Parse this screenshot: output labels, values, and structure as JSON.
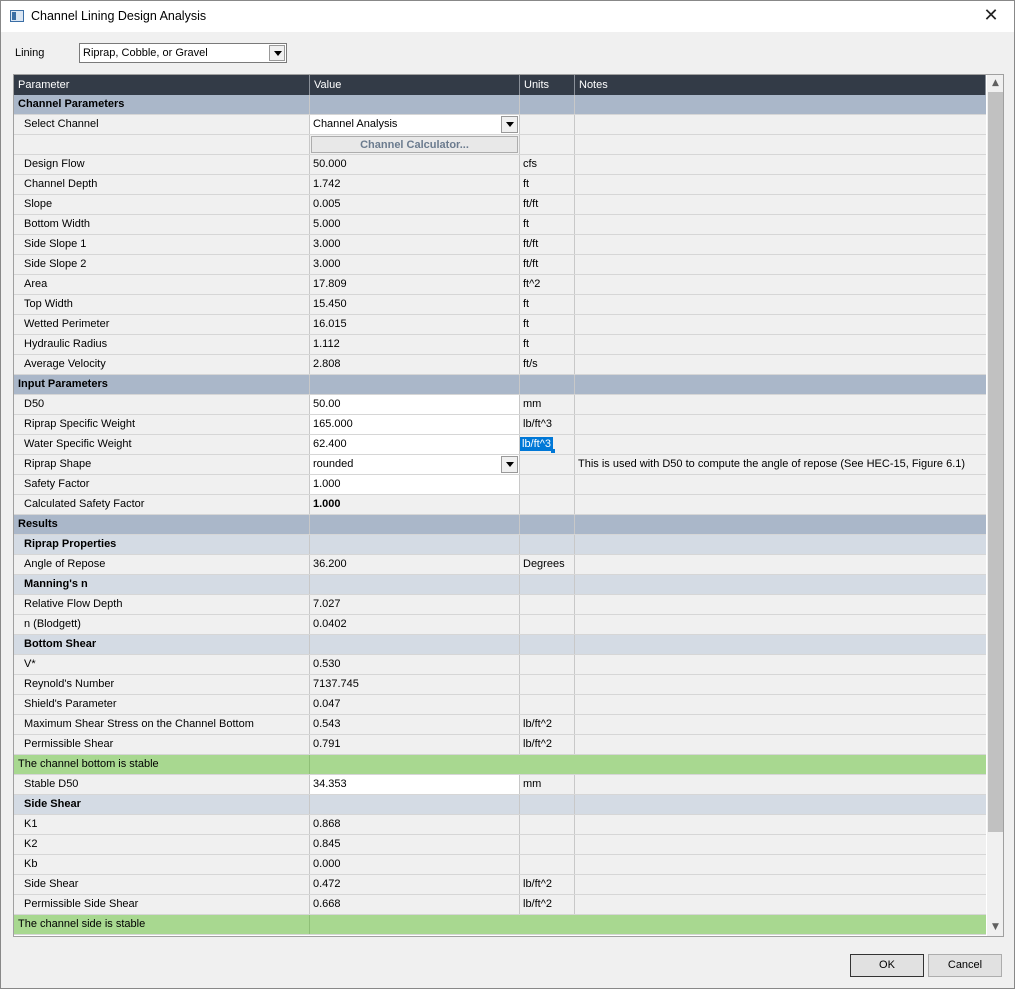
{
  "window": {
    "title": "Channel Lining Design Analysis",
    "close_glyph": "✕"
  },
  "lining": {
    "label": "Lining",
    "value": "Riprap, Cobble, or Gravel"
  },
  "grid": {
    "headers": [
      "Parameter",
      "Value",
      "Units",
      "Notes"
    ],
    "sections": {
      "channel_parameters": "Channel Parameters",
      "input_parameters": "Input Parameters",
      "results": "Results",
      "riprap_properties": "Riprap Properties",
      "mannings_n": "Manning's n",
      "bottom_shear": "Bottom Shear",
      "side_shear": "Side Shear"
    },
    "select_channel": {
      "label": "Select Channel",
      "value": "Channel Analysis"
    },
    "calculator_button": "Channel Calculator...",
    "channel_rows": [
      {
        "label": "Design Flow",
        "value": "50.000",
        "units": "cfs"
      },
      {
        "label": "Channel Depth",
        "value": "1.742",
        "units": "ft"
      },
      {
        "label": "Slope",
        "value": "0.005",
        "units": "ft/ft"
      },
      {
        "label": "Bottom Width",
        "value": "5.000",
        "units": "ft"
      },
      {
        "label": "Side Slope 1",
        "value": "3.000",
        "units": "ft/ft"
      },
      {
        "label": "Side Slope 2",
        "value": "3.000",
        "units": "ft/ft"
      },
      {
        "label": "Area",
        "value": "17.809",
        "units": "ft^2"
      },
      {
        "label": "Top Width",
        "value": "15.450",
        "units": "ft"
      },
      {
        "label": "Wetted Perimeter",
        "value": "16.015",
        "units": "ft"
      },
      {
        "label": "Hydraulic Radius",
        "value": "1.112",
        "units": "ft"
      },
      {
        "label": "Average Velocity",
        "value": "2.808",
        "units": "ft/s"
      }
    ],
    "d50": {
      "label": "D50",
      "value": "50.00",
      "units": "mm"
    },
    "riprap_sw": {
      "label": "Riprap Specific Weight",
      "value": "165.000",
      "units": "lb/ft^3"
    },
    "water_sw": {
      "label": "Water Specific Weight",
      "value": "62.400",
      "units": "lb/ft^3"
    },
    "riprap_shape": {
      "label": "Riprap Shape",
      "value": "rounded",
      "notes": "This is used with D50 to compute the angle of repose (See HEC-15, Figure 6.1)"
    },
    "safety_factor": {
      "label": "Safety Factor",
      "value": "1.000"
    },
    "calc_safety_factor": {
      "label": "Calculated Safety Factor",
      "value": "1.000"
    },
    "angle_of_repose": {
      "label": "Angle of Repose",
      "value": "36.200",
      "units": "Degrees"
    },
    "relative_flow_depth": {
      "label": "Relative Flow Depth",
      "value": "7.027"
    },
    "n_blodgett": {
      "label": "n (Blodgett)",
      "value": "0.0402"
    },
    "bottom_rows": [
      {
        "label": "V*",
        "value": "0.530",
        "units": ""
      },
      {
        "label": "Reynold's Number",
        "value": "7137.745",
        "units": ""
      },
      {
        "label": "Shield's Parameter",
        "value": "0.047",
        "units": ""
      },
      {
        "label": "Maximum Shear Stress on the Channel Bottom",
        "value": "0.543",
        "units": "lb/ft^2"
      },
      {
        "label": "Permissible Shear",
        "value": "0.791",
        "units": "lb/ft^2"
      }
    ],
    "bottom_stable_msg": "The channel bottom is stable",
    "stable_d50": {
      "label": "Stable D50",
      "value": "34.353",
      "units": "mm"
    },
    "side_rows": [
      {
        "label": "K1",
        "value": "0.868",
        "units": ""
      },
      {
        "label": "K2",
        "value": "0.845",
        "units": ""
      },
      {
        "label": "Kb",
        "value": "0.000",
        "units": ""
      },
      {
        "label": "Side Shear",
        "value": "0.472",
        "units": "lb/ft^2"
      },
      {
        "label": "Permissible Side Shear",
        "value": "0.668",
        "units": "lb/ft^2"
      }
    ],
    "side_stable_msg": "The channel side is stable"
  },
  "scrollbar": {
    "up_glyph": "▲",
    "down_glyph": "▼"
  },
  "buttons": {
    "ok": "OK",
    "cancel": "Cancel"
  },
  "colors": {
    "header_bg": "#333b47",
    "section_bg": "#aab7c9",
    "subsection_bg": "#d4dbe4",
    "stable_bg": "#a8d890",
    "selection": "#0078d7"
  }
}
